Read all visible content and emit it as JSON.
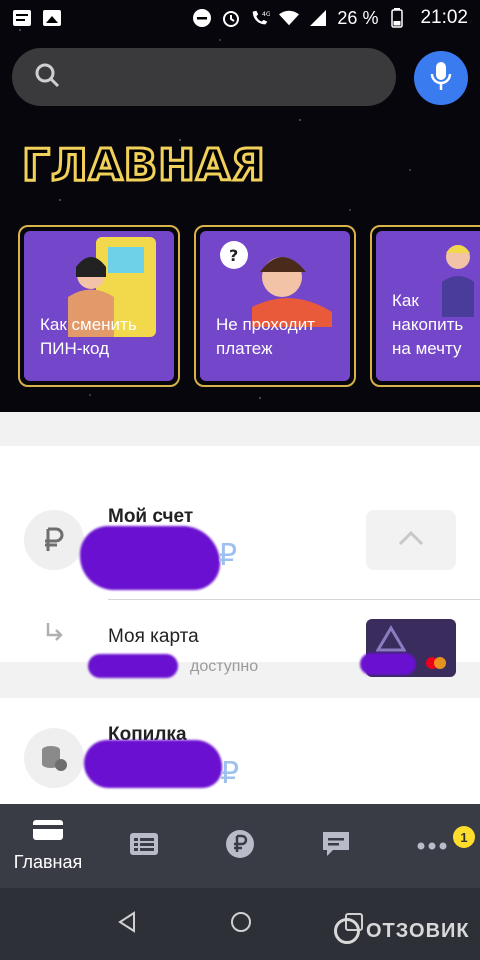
{
  "status_bar": {
    "battery_percent": "26 %",
    "time": "21:02",
    "network": "4G"
  },
  "search": {
    "placeholder": ""
  },
  "page": {
    "title": "ГЛАВНАЯ"
  },
  "stories": [
    {
      "label": "Как сменить\nПИН-код"
    },
    {
      "label": "Не проходит\nплатеж"
    },
    {
      "label": "Как\nнакопить\nна мечту"
    }
  ],
  "accounts": {
    "main": {
      "name": "Мой счет",
      "currency_symbol": "₽",
      "icon": "ruble-icon"
    },
    "card": {
      "name": "Моя карта",
      "available_label": "доступно"
    },
    "savings": {
      "name": "Копилка",
      "currency_symbol": "₽",
      "icon": "coins-icon"
    }
  },
  "tabbar": {
    "home_label": "Главная",
    "more_badge": "1"
  },
  "watermark": {
    "text": "ОТЗОВИК"
  },
  "colors": {
    "accent_blue": "#3b7bf0",
    "story_purple": "#7446c9",
    "title_gold": "#f2d15a",
    "tabbar_bg": "#3a3c45",
    "badge_yellow": "#ffdd2d"
  }
}
